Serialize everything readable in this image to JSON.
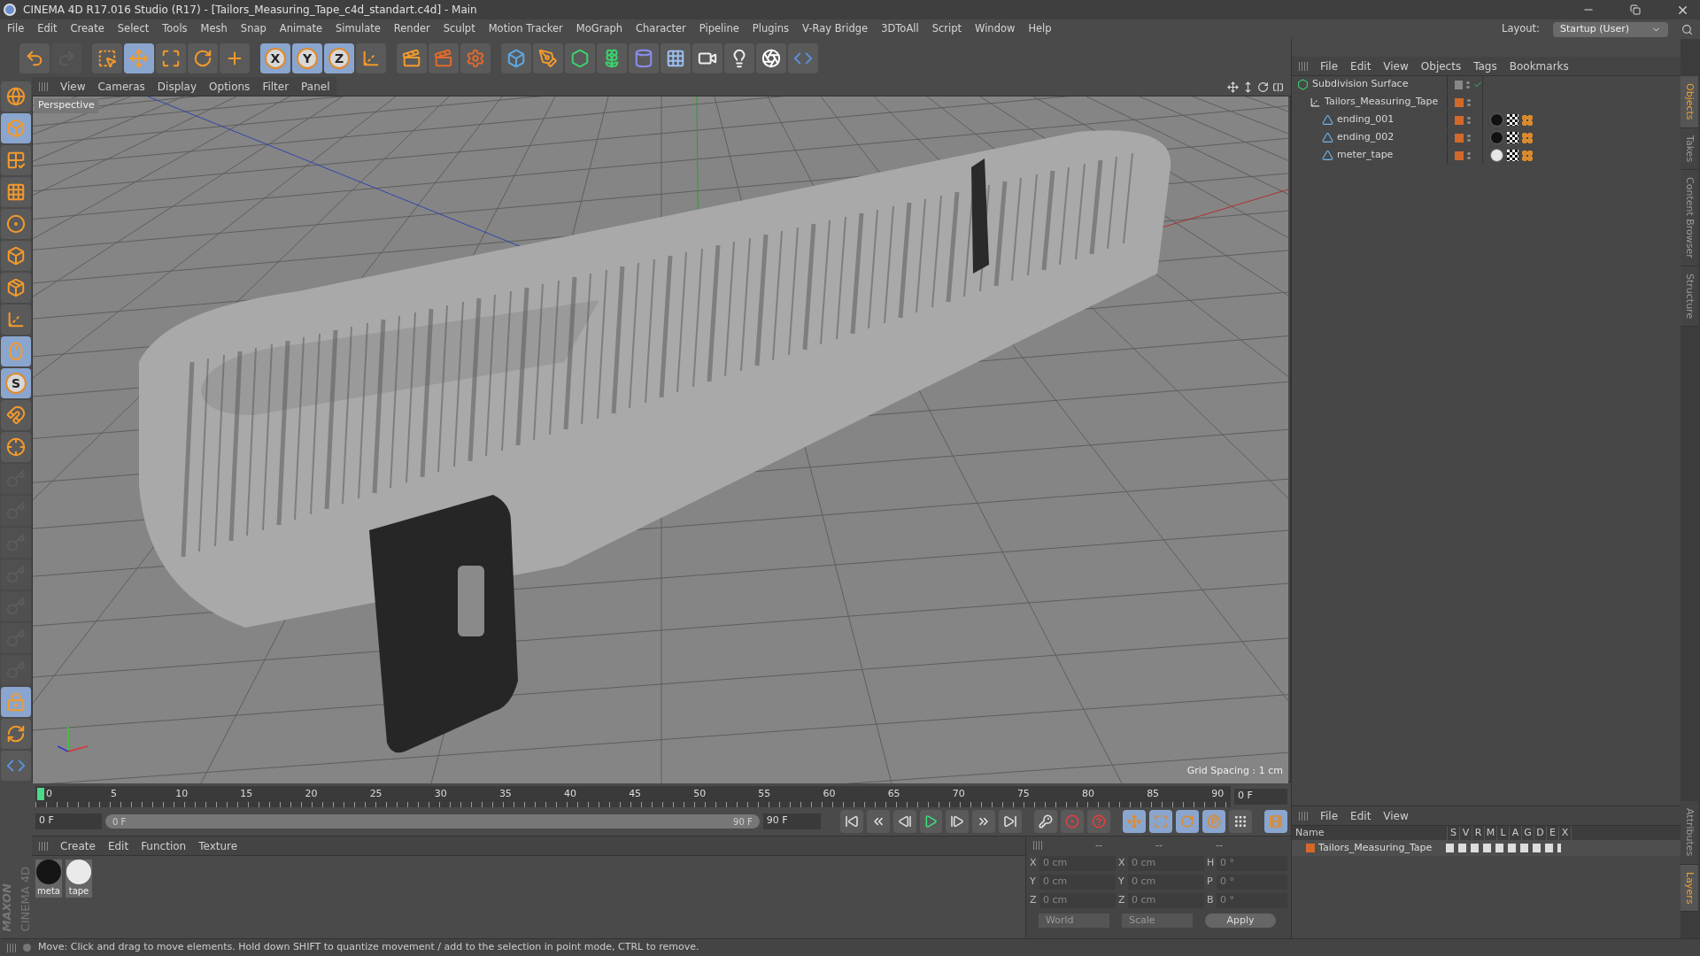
{
  "window": {
    "title": "CINEMA 4D R17.016 Studio (R17) - [Tailors_Measuring_Tape_c4d_standart.c4d] - Main"
  },
  "menu": [
    "File",
    "Edit",
    "Create",
    "Select",
    "Tools",
    "Mesh",
    "Snap",
    "Animate",
    "Simulate",
    "Render",
    "Sculpt",
    "Motion Tracker",
    "MoGraph",
    "Character",
    "Pipeline",
    "Plugins",
    "V-Ray Bridge",
    "3DToAll",
    "Script",
    "Window",
    "Help"
  ],
  "layout": {
    "label": "Layout:",
    "value": "Startup (User)"
  },
  "toolbar": [
    {
      "kind": "undo",
      "selected": false,
      "disabled": false
    },
    {
      "kind": "redo",
      "selected": false,
      "disabled": true
    },
    {
      "kind": "select",
      "selected": false,
      "disabled": false
    },
    {
      "kind": "move",
      "selected": true,
      "disabled": false
    },
    {
      "kind": "scale",
      "selected": false,
      "disabled": false
    },
    {
      "kind": "rotate",
      "selected": false,
      "disabled": false
    },
    {
      "kind": "add",
      "selected": false,
      "disabled": false
    },
    {
      "kind": "axis",
      "label": "X",
      "selected": true,
      "disabled": false
    },
    {
      "kind": "axis",
      "label": "Y",
      "selected": true,
      "disabled": false
    },
    {
      "kind": "axis",
      "label": "Z",
      "selected": true,
      "disabled": false
    },
    {
      "kind": "coords",
      "selected": false,
      "disabled": false
    },
    {
      "kind": "render-view",
      "selected": false,
      "disabled": false
    },
    {
      "kind": "render",
      "selected": false,
      "disabled": false
    },
    {
      "kind": "render-settings",
      "selected": false,
      "disabled": false
    },
    {
      "kind": "cube",
      "selected": false,
      "disabled": false
    },
    {
      "kind": "pen",
      "selected": false,
      "disabled": false
    },
    {
      "kind": "subdivision",
      "selected": false,
      "disabled": false
    },
    {
      "kind": "cloner",
      "selected": false,
      "disabled": false
    },
    {
      "kind": "deformer",
      "selected": false,
      "disabled": false
    },
    {
      "kind": "floor",
      "selected": false,
      "disabled": false
    },
    {
      "kind": "camera",
      "selected": false,
      "disabled": false
    },
    {
      "kind": "light",
      "selected": false,
      "disabled": false
    },
    {
      "kind": "sketch",
      "selected": false,
      "disabled": false
    },
    {
      "kind": "python",
      "selected": false,
      "disabled": false
    }
  ],
  "left_toolbar": [
    {
      "kind": "globe",
      "selected": false,
      "disabled": false
    },
    {
      "kind": "model",
      "selected": true,
      "disabled": false
    },
    {
      "kind": "texture",
      "selected": false,
      "disabled": false
    },
    {
      "kind": "workplane",
      "selected": false,
      "disabled": false
    },
    {
      "kind": "points",
      "selected": false,
      "disabled": false
    },
    {
      "kind": "edges",
      "selected": false,
      "disabled": false
    },
    {
      "kind": "polygons",
      "selected": false,
      "disabled": false
    },
    {
      "kind": "axis-mode",
      "selected": false,
      "disabled": false
    },
    {
      "kind": "tweak",
      "selected": true,
      "disabled": false
    },
    {
      "kind": "snap",
      "label": "S",
      "selected": true,
      "disabled": false
    },
    {
      "kind": "magnet",
      "selected": false,
      "disabled": false
    },
    {
      "kind": "locked-axis",
      "selected": false,
      "disabled": false
    },
    {
      "kind": "key",
      "selected": false,
      "disabled": true
    },
    {
      "kind": "key",
      "selected": false,
      "disabled": true
    },
    {
      "kind": "key",
      "selected": false,
      "disabled": true
    },
    {
      "kind": "key",
      "selected": false,
      "disabled": true
    },
    {
      "kind": "key",
      "selected": false,
      "disabled": true
    },
    {
      "kind": "key",
      "selected": false,
      "disabled": true
    },
    {
      "kind": "key",
      "selected": false,
      "disabled": true
    },
    {
      "kind": "grid-lock",
      "selected": true,
      "disabled": false
    },
    {
      "kind": "grid-rotate",
      "selected": false,
      "disabled": false
    },
    {
      "kind": "python",
      "selected": false,
      "disabled": false
    }
  ],
  "logo": {
    "brand": "MAXON",
    "product": "CINEMA 4D"
  },
  "viewport": {
    "menu": [
      "View",
      "Cameras",
      "Display",
      "Options",
      "Filter",
      "Panel"
    ],
    "camera": "Perspective",
    "grid_spacing": "Grid Spacing : 1 cm"
  },
  "timeline": {
    "range_slider": {
      "level": 1
    },
    "ticks": [
      "0",
      "5",
      "10",
      "15",
      "20",
      "25",
      "30",
      "35",
      "40",
      "45",
      "50",
      "55",
      "60",
      "65",
      "70",
      "75",
      "80",
      "85",
      "90"
    ],
    "current": "0 F",
    "start": "0 F",
    "range_start": "0 F",
    "range_end": "90 F",
    "end": "90 F"
  },
  "transport": [
    {
      "kind": "first",
      "selected": false
    },
    {
      "kind": "prev-key",
      "selected": false
    },
    {
      "kind": "prev",
      "selected": false
    },
    {
      "kind": "play",
      "selected": false
    },
    {
      "kind": "next",
      "selected": false
    },
    {
      "kind": "next-key",
      "selected": false
    },
    {
      "kind": "last",
      "selected": false
    },
    {
      "kind": "keys",
      "selected": false
    },
    {
      "kind": "record",
      "selected": false
    },
    {
      "kind": "autokey",
      "selected": false
    },
    {
      "kind": "move",
      "selected": true
    },
    {
      "kind": "scale",
      "selected": true
    },
    {
      "kind": "rotate",
      "selected": true
    },
    {
      "kind": "param",
      "selected": true
    },
    {
      "kind": "dots",
      "selected": false
    },
    {
      "kind": "film",
      "selected": true
    }
  ],
  "material_manager": {
    "menu": [
      "Create",
      "Edit",
      "Function",
      "Texture"
    ],
    "materials": [
      {
        "name": "meta",
        "kind": "dark"
      },
      {
        "name": "tape",
        "kind": "light"
      }
    ]
  },
  "coordinates": {
    "headers": [
      "--",
      "--",
      "--"
    ],
    "rows": [
      {
        "axis": "X",
        "position": "0 cm",
        "size_axis": "X",
        "size": "0 cm",
        "rot_axis": "H",
        "rotation": "0 °"
      },
      {
        "axis": "Y",
        "position": "0 cm",
        "size_axis": "Y",
        "size": "0 cm",
        "rot_axis": "P",
        "rotation": "0 °"
      },
      {
        "axis": "Z",
        "position": "0 cm",
        "size_axis": "Z",
        "size": "0 cm",
        "rot_axis": "B",
        "rotation": "0 °"
      }
    ],
    "mode": "World",
    "transform": "Scale",
    "apply": "Apply"
  },
  "object_manager": {
    "menu": [
      "File",
      "Edit",
      "View",
      "Objects",
      "Tags",
      "Bookmarks"
    ],
    "objects": [
      {
        "name": "Subdivision Surface",
        "kind": "subdivision",
        "children": [
          {
            "name": "Tailors_Measuring_Tape",
            "kind": "null",
            "children": [
              {
                "name": "ending_001",
                "kind": "polygon",
                "dark_material": true
              },
              {
                "name": "ending_002",
                "kind": "polygon",
                "dark_material": true
              },
              {
                "name": "meter_tape",
                "kind": "polygon",
                "dark_material": false
              }
            ]
          }
        ]
      }
    ]
  },
  "layer_manager": {
    "menu": [
      "File",
      "Edit",
      "View"
    ],
    "columns": [
      "Name",
      "S",
      "V",
      "R",
      "M",
      "L",
      "A",
      "G",
      "D",
      "E",
      "X"
    ],
    "layers": [
      {
        "name": "Tailors_Measuring_Tape",
        "color": "#d2692a"
      }
    ]
  },
  "side_tabs": [
    {
      "label": "Objects",
      "selected": true
    },
    {
      "label": "Takes",
      "selected": false
    },
    {
      "label": "Content Browser",
      "selected": false
    },
    {
      "label": "Structure",
      "selected": false
    }
  ],
  "side_tabs_bottom": [
    {
      "label": "Attributes",
      "selected": false
    },
    {
      "label": "Layers",
      "selected": true
    }
  ],
  "status_bar": "Move: Click and drag to move elements. Hold down SHIFT to quantize movement / add to the selection in point mode, CTRL to remove."
}
